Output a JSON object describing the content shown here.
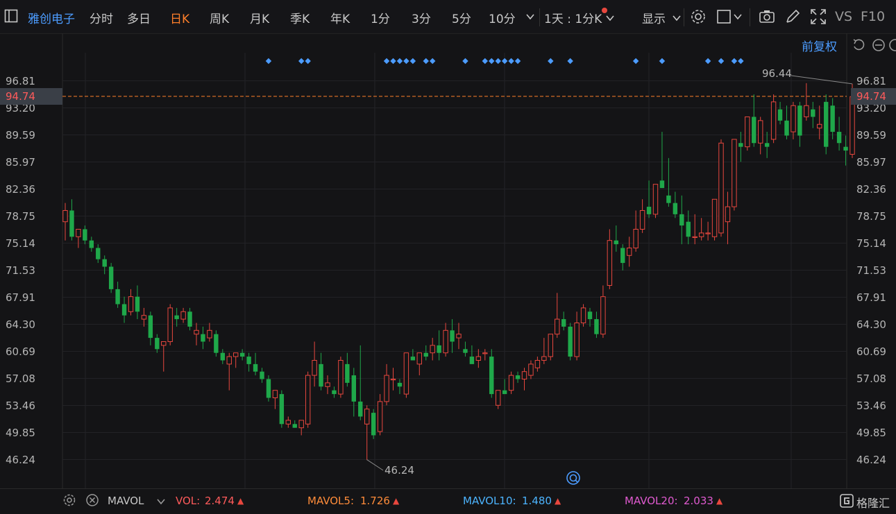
{
  "toolbar": {
    "stock_name": "雅创电子",
    "periods": [
      "分时",
      "多日",
      "日K",
      "周K",
      "月K",
      "季K",
      "年K",
      "1分",
      "3分",
      "5分",
      "10分"
    ],
    "active_period": "日K",
    "more_chevron": "chevron-down-icon",
    "interval_label": "1天 : 1分K",
    "display_label": "显示",
    "vs_label": "VS",
    "f10_label": "F10",
    "icons": [
      "panel-toggle-icon",
      "settings-icon",
      "square-icon",
      "camera-icon",
      "pen-icon",
      "fullscreen-icon"
    ]
  },
  "chart_header": {
    "adjust_label": "前复权"
  },
  "price_axis": {
    "labels": [
      "96.81",
      "93.20",
      "89.59",
      "85.97",
      "82.36",
      "78.75",
      "75.14",
      "71.53",
      "67.91",
      "64.30",
      "60.69",
      "57.08",
      "53.46",
      "49.85",
      "46.24"
    ],
    "current_price": "94.74",
    "high_annotation": "96.44",
    "low_annotation": "46.24"
  },
  "colors": {
    "up": "#e8473e",
    "down": "#1fa84a",
    "accent": "#ff7f2a",
    "marker": "#4c9cff"
  },
  "chart_data": {
    "type": "candlestick",
    "ylim": [
      44.5,
      99.5
    ],
    "ohlc": [
      [
        78.0,
        80.5,
        75.5,
        79.5
      ],
      [
        79.5,
        81.0,
        75.5,
        76.0
      ],
      [
        76.0,
        77.0,
        74.5,
        77.0
      ],
      [
        77.0,
        77.5,
        75.0,
        75.5
      ],
      [
        75.5,
        76.0,
        74.0,
        74.5
      ],
      [
        74.5,
        75.0,
        72.5,
        73.0
      ],
      [
        73.0,
        73.5,
        71.0,
        72.0
      ],
      [
        72.0,
        72.5,
        68.5,
        69.0
      ],
      [
        69.0,
        70.0,
        66.5,
        67.0
      ],
      [
        67.0,
        68.0,
        64.5,
        65.5
      ],
      [
        66.0,
        69.0,
        65.5,
        68.0
      ],
      [
        68.0,
        69.5,
        65.0,
        66.0
      ],
      [
        65.0,
        66.5,
        64.0,
        65.5
      ],
      [
        65.5,
        66.0,
        61.5,
        62.5
      ],
      [
        62.5,
        63.0,
        60.5,
        61.0
      ],
      [
        61.5,
        62.0,
        58.0,
        62.0
      ],
      [
        62.0,
        67.0,
        61.5,
        66.5
      ],
      [
        65.5,
        66.5,
        64.0,
        65.0
      ],
      [
        65.0,
        66.5,
        64.5,
        66.0
      ],
      [
        66.0,
        66.5,
        63.5,
        64.0
      ],
      [
        63.0,
        64.5,
        61.5,
        63.5
      ],
      [
        63.0,
        64.0,
        61.0,
        62.0
      ],
      [
        62.5,
        64.5,
        62.0,
        63.5
      ],
      [
        63.0,
        63.5,
        60.0,
        60.5
      ],
      [
        60.5,
        61.0,
        59.0,
        59.5
      ],
      [
        59.0,
        60.5,
        55.5,
        60.0
      ],
      [
        60.0,
        60.5,
        58.5,
        60.5
      ],
      [
        60.5,
        61.0,
        59.5,
        60.0
      ],
      [
        60.0,
        60.5,
        58.0,
        59.0
      ],
      [
        59.0,
        60.5,
        57.5,
        58.0
      ],
      [
        58.0,
        58.5,
        56.5,
        57.0
      ],
      [
        57.0,
        57.5,
        54.0,
        54.5
      ],
      [
        54.5,
        55.0,
        53.0,
        55.5
      ],
      [
        55.0,
        55.5,
        50.5,
        51.0
      ],
      [
        51.0,
        52.0,
        50.5,
        51.5
      ],
      [
        51.0,
        51.5,
        50.5,
        50.5
      ],
      [
        50.5,
        51.5,
        49.5,
        51.5
      ],
      [
        51.0,
        58.0,
        50.5,
        57.5
      ],
      [
        57.5,
        62.0,
        56.0,
        59.5
      ],
      [
        59.0,
        60.5,
        55.5,
        56.0
      ],
      [
        56.0,
        57.5,
        55.0,
        56.5
      ],
      [
        55.5,
        56.0,
        54.5,
        55.0
      ],
      [
        55.0,
        60.0,
        54.5,
        59.5
      ],
      [
        59.0,
        60.5,
        56.0,
        56.5
      ],
      [
        57.5,
        58.5,
        52.0,
        54.0
      ],
      [
        54.0,
        61.5,
        51.5,
        52.0
      ],
      [
        51.0,
        53.5,
        46.2,
        53.0
      ],
      [
        52.5,
        53.0,
        49.0,
        49.5
      ],
      [
        50.0,
        55.0,
        49.5,
        54.0
      ],
      [
        54.0,
        59.0,
        53.5,
        57.5
      ],
      [
        57.0,
        58.5,
        55.5,
        57.0
      ],
      [
        56.5,
        57.0,
        55.0,
        56.0
      ],
      [
        55.0,
        60.5,
        54.5,
        60.5
      ],
      [
        60.0,
        61.0,
        59.5,
        59.5
      ],
      [
        59.0,
        60.0,
        57.5,
        60.5
      ],
      [
        60.5,
        61.5,
        59.5,
        60.0
      ],
      [
        60.5,
        62.5,
        59.5,
        61.5
      ],
      [
        61.5,
        63.5,
        59.5,
        60.5
      ],
      [
        60.5,
        64.5,
        60.0,
        63.5
      ],
      [
        63.5,
        65.0,
        60.5,
        62.0
      ],
      [
        62.5,
        64.5,
        61.0,
        63.0
      ],
      [
        61.0,
        62.0,
        60.0,
        60.5
      ],
      [
        60.0,
        61.5,
        59.5,
        59.0
      ],
      [
        59.5,
        61.0,
        58.5,
        60.0
      ],
      [
        60.5,
        61.0,
        59.5,
        60.5
      ],
      [
        60.0,
        61.0,
        54.5,
        55.0
      ],
      [
        53.5,
        55.5,
        53.0,
        55.5
      ],
      [
        55.5,
        57.0,
        55.0,
        55.0
      ],
      [
        55.5,
        58.0,
        55.0,
        57.5
      ],
      [
        57.5,
        58.0,
        56.5,
        57.0
      ],
      [
        57.0,
        58.5,
        55.5,
        58.0
      ],
      [
        57.5,
        59.5,
        57.0,
        59.0
      ],
      [
        58.5,
        60.0,
        58.0,
        59.5
      ],
      [
        59.5,
        62.5,
        59.0,
        60.0
      ],
      [
        60.0,
        63.0,
        59.5,
        63.0
      ],
      [
        63.0,
        68.5,
        62.5,
        65.0
      ],
      [
        65.0,
        66.0,
        63.5,
        64.0
      ],
      [
        64.0,
        64.5,
        59.5,
        60.0
      ],
      [
        60.0,
        66.0,
        59.5,
        64.5
      ],
      [
        64.5,
        67.0,
        64.0,
        66.5
      ],
      [
        66.0,
        66.5,
        64.0,
        65.0
      ],
      [
        65.0,
        66.0,
        62.5,
        63.0
      ],
      [
        63.0,
        69.5,
        62.5,
        68.0
      ],
      [
        69.5,
        77.0,
        69.0,
        75.5
      ],
      [
        75.5,
        77.5,
        74.0,
        75.0
      ],
      [
        74.5,
        75.0,
        71.5,
        72.5
      ],
      [
        73.5,
        76.0,
        72.0,
        74.5
      ],
      [
        74.5,
        79.5,
        74.0,
        77.0
      ],
      [
        77.0,
        81.0,
        76.5,
        79.5
      ],
      [
        80.0,
        83.5,
        78.5,
        79.0
      ],
      [
        79.0,
        82.5,
        78.5,
        83.0
      ],
      [
        83.5,
        90.0,
        82.5,
        82.5
      ],
      [
        81.5,
        86.5,
        80.0,
        80.5
      ],
      [
        80.5,
        82.0,
        78.5,
        79.0
      ],
      [
        79.0,
        81.5,
        75.0,
        77.5
      ],
      [
        78.0,
        79.5,
        75.0,
        76.0
      ],
      [
        76.0,
        79.0,
        75.0,
        76.0
      ],
      [
        76.0,
        78.5,
        75.5,
        76.5
      ],
      [
        76.5,
        78.0,
        75.5,
        76.5
      ],
      [
        76.0,
        81.0,
        75.5,
        81.0
      ],
      [
        76.5,
        89.0,
        76.0,
        88.5
      ],
      [
        78.0,
        82.0,
        75.0,
        80.0
      ],
      [
        80.0,
        88.5,
        79.5,
        89.0
      ],
      [
        88.5,
        90.0,
        86.0,
        88.0
      ],
      [
        88.0,
        91.5,
        87.5,
        92.0
      ],
      [
        92.0,
        95.0,
        88.0,
        88.5
      ],
      [
        88.5,
        92.0,
        87.0,
        91.5
      ],
      [
        88.5,
        90.0,
        86.5,
        88.0
      ],
      [
        89.0,
        95.0,
        88.5,
        94.0
      ],
      [
        93.0,
        94.0,
        91.0,
        91.5
      ],
      [
        91.5,
        93.5,
        89.0,
        89.5
      ],
      [
        90.0,
        94.0,
        89.0,
        93.5
      ],
      [
        93.5,
        94.0,
        88.0,
        89.5
      ],
      [
        92.0,
        96.5,
        91.5,
        93.5
      ],
      [
        93.0,
        94.0,
        90.5,
        92.0
      ],
      [
        90.5,
        93.5,
        89.0,
        91.0
      ],
      [
        94.0,
        95.0,
        87.0,
        88.0
      ],
      [
        93.5,
        94.5,
        89.0,
        90.0
      ],
      [
        90.0,
        92.0,
        87.5,
        88.5
      ],
      [
        88.0,
        89.5,
        85.5,
        87.5
      ],
      [
        87.0,
        96.4,
        86.5,
        94.7
      ]
    ],
    "marker_positions": [
      31,
      36,
      37,
      49,
      50,
      51,
      52,
      53,
      55,
      56,
      61,
      64,
      65,
      66,
      67,
      68,
      69,
      74,
      77,
      87,
      91,
      98,
      100,
      102,
      103
    ]
  },
  "footer": {
    "indicator_name": "MAVOL",
    "vol_label": "VOL:",
    "vol_value": "2.474",
    "mavol5_label": "MAVOL5:",
    "mavol5_value": "1.726",
    "mavol10_label": "MAVOL10:",
    "mavol10_value": "1.480",
    "mavol20_label": "MAVOL20:",
    "mavol20_value": "2.033",
    "brand": "格隆汇"
  }
}
